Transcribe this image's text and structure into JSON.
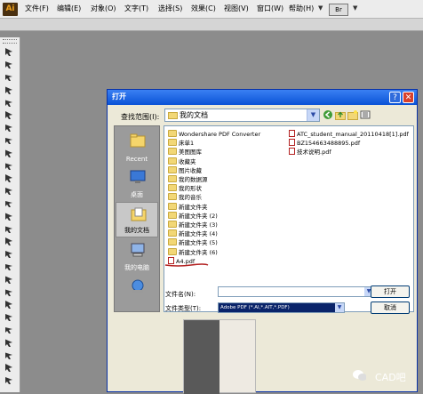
{
  "app": {
    "logo": "Ai"
  },
  "menu": [
    "文件(F)",
    "编辑(E)",
    "对象(O)",
    "文字(T)",
    "选择(S)",
    "效果(C)",
    "视图(V)",
    "窗口(W)",
    "帮助(H)"
  ],
  "menu_extra": {
    "bridge": "Br"
  },
  "tools": [
    "selection-tool",
    "direct-selection-tool",
    "magic-wand-tool",
    "lasso-tool",
    "pen-tool",
    "type-tool",
    "line-tool",
    "rectangle-tool",
    "paintbrush-tool",
    "pencil-tool",
    "eraser-tool",
    "rotate-tool",
    "scale-tool",
    "warp-tool",
    "free-transform-tool",
    "symbol-sprayer-tool",
    "column-graph-tool",
    "mesh-tool",
    "gradient-tool",
    "eyedropper-tool",
    "blend-tool",
    "live-paint-tool",
    "crop-tool",
    "slice-tool",
    "scissors-tool",
    "hand-tool",
    "zoom-tool"
  ],
  "dialog": {
    "title": "打开",
    "look_in_label": "查找范围(I):",
    "look_in_value": "我的文档",
    "places": [
      {
        "label": "Recent",
        "icon": "recent-folder-icon"
      },
      {
        "label": "桌面",
        "icon": "desktop-icon"
      },
      {
        "label": "我的文档",
        "icon": "my-documents-icon"
      },
      {
        "label": "我的电脑",
        "icon": "my-computer-icon"
      },
      {
        "label": "",
        "icon": "network-icon"
      }
    ],
    "files_left": [
      {
        "name": "Wondershare PDF Converter",
        "type": "folder"
      },
      {
        "name": "床单1",
        "type": "folder"
      },
      {
        "name": "美图图库",
        "type": "folder"
      },
      {
        "name": "收藏夹",
        "type": "folder"
      },
      {
        "name": "图片收藏",
        "type": "folder"
      },
      {
        "name": "我的数据源",
        "type": "folder"
      },
      {
        "name": "我的形状",
        "type": "folder"
      },
      {
        "name": "我的音乐",
        "type": "folder"
      },
      {
        "name": "新建文件夹",
        "type": "folder"
      },
      {
        "name": "新建文件夹 (2)",
        "type": "folder"
      },
      {
        "name": "新建文件夹 (3)",
        "type": "folder"
      },
      {
        "name": "新建文件夹 (4)",
        "type": "folder"
      },
      {
        "name": "新建文件夹 (5)",
        "type": "folder"
      },
      {
        "name": "新建文件夹 (6)",
        "type": "folder"
      },
      {
        "name": "A4.pdf",
        "type": "pdf"
      }
    ],
    "files_right": [
      {
        "name": "ATC_student_manual_20110418[1].pdf",
        "type": "pdf"
      },
      {
        "name": "BZ154663488895.pdf",
        "type": "pdf"
      },
      {
        "name": "技术说明.pdf",
        "type": "pdf"
      }
    ],
    "file_name_label": "文件名(N):",
    "file_name_value": "",
    "file_type_label": "文件类型(T):",
    "file_type_value": "Adobe PDF (*.AI,*.AIT,*.PDF)",
    "open_button": "打开",
    "cancel_button": "取消"
  },
  "watermark": {
    "text": "CAD吧"
  },
  "colors": {
    "titlebar": "#0a52d6",
    "accent_red": "#b32222",
    "background": "#8c8c8c"
  }
}
